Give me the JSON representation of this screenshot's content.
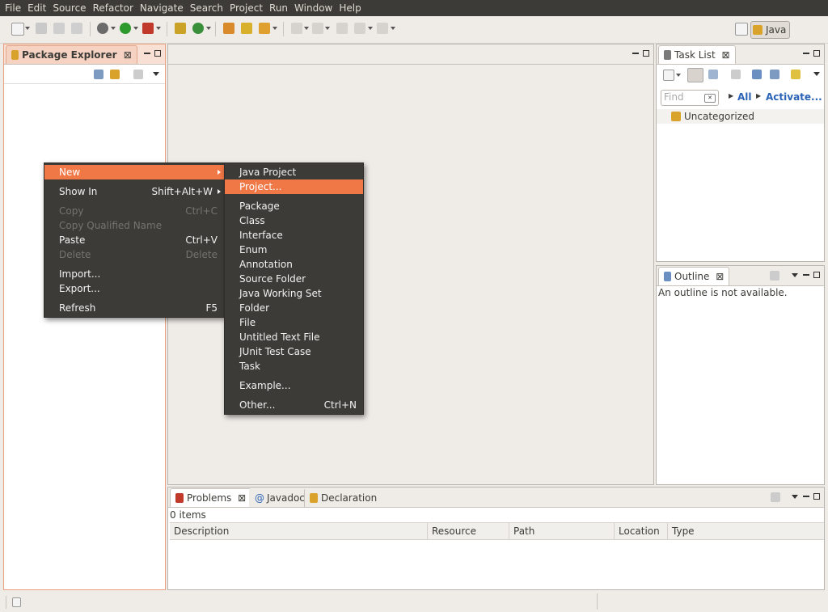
{
  "menubar": [
    "File",
    "Edit",
    "Source",
    "Refactor",
    "Navigate",
    "Search",
    "Project",
    "Run",
    "Window",
    "Help"
  ],
  "perspective": {
    "label": "Java"
  },
  "package_explorer": {
    "title": "Package Explorer",
    "close": "⊠"
  },
  "context_menu": {
    "items": [
      {
        "label": "New",
        "accel": "",
        "submenu": true,
        "disabled": false,
        "highlight": true
      },
      {
        "sep": true
      },
      {
        "label": "Show In",
        "accel": "Shift+Alt+W",
        "submenu": true,
        "disabled": false
      },
      {
        "sep": true
      },
      {
        "label": "Copy",
        "accel": "Ctrl+C",
        "disabled": true
      },
      {
        "label": "Copy Qualified Name",
        "accel": "",
        "disabled": true
      },
      {
        "label": "Paste",
        "accel": "Ctrl+V",
        "disabled": false
      },
      {
        "label": "Delete",
        "accel": "Delete",
        "disabled": true
      },
      {
        "sep": true
      },
      {
        "label": "Import...",
        "accel": "",
        "disabled": false
      },
      {
        "label": "Export...",
        "accel": "",
        "disabled": false
      },
      {
        "sep": true
      },
      {
        "label": "Refresh",
        "accel": "F5",
        "disabled": false
      }
    ]
  },
  "new_submenu": {
    "items": [
      {
        "label": "Java Project",
        "accel": ""
      },
      {
        "label": "Project...",
        "accel": "",
        "highlight": true
      },
      {
        "sep": true
      },
      {
        "label": "Package",
        "accel": ""
      },
      {
        "label": "Class",
        "accel": ""
      },
      {
        "label": "Interface",
        "accel": ""
      },
      {
        "label": "Enum",
        "accel": ""
      },
      {
        "label": "Annotation",
        "accel": ""
      },
      {
        "label": "Source Folder",
        "accel": ""
      },
      {
        "label": "Java Working Set",
        "accel": ""
      },
      {
        "label": "Folder",
        "accel": ""
      },
      {
        "label": "File",
        "accel": ""
      },
      {
        "label": "Untitled Text File",
        "accel": ""
      },
      {
        "label": "JUnit Test Case",
        "accel": ""
      },
      {
        "label": "Task",
        "accel": ""
      },
      {
        "sep": true
      },
      {
        "label": "Example...",
        "accel": ""
      },
      {
        "sep": true
      },
      {
        "label": "Other...",
        "accel": "Ctrl+N"
      }
    ]
  },
  "task_list": {
    "title": "Task List",
    "find_placeholder": "Find",
    "filter_all": "All",
    "filter_activate": "Activate...",
    "category": "Uncategorized"
  },
  "outline": {
    "title": "Outline",
    "message": "An outline is not available."
  },
  "problems": {
    "tabs": [
      "Problems",
      "Javadoc",
      "Declaration"
    ],
    "count": "0 items",
    "columns": [
      "Description",
      "Resource",
      "Path",
      "Location",
      "Type"
    ]
  },
  "colors": {
    "accent": "#f07746",
    "menubar": "#3c3b37",
    "link": "#2a63b5"
  }
}
